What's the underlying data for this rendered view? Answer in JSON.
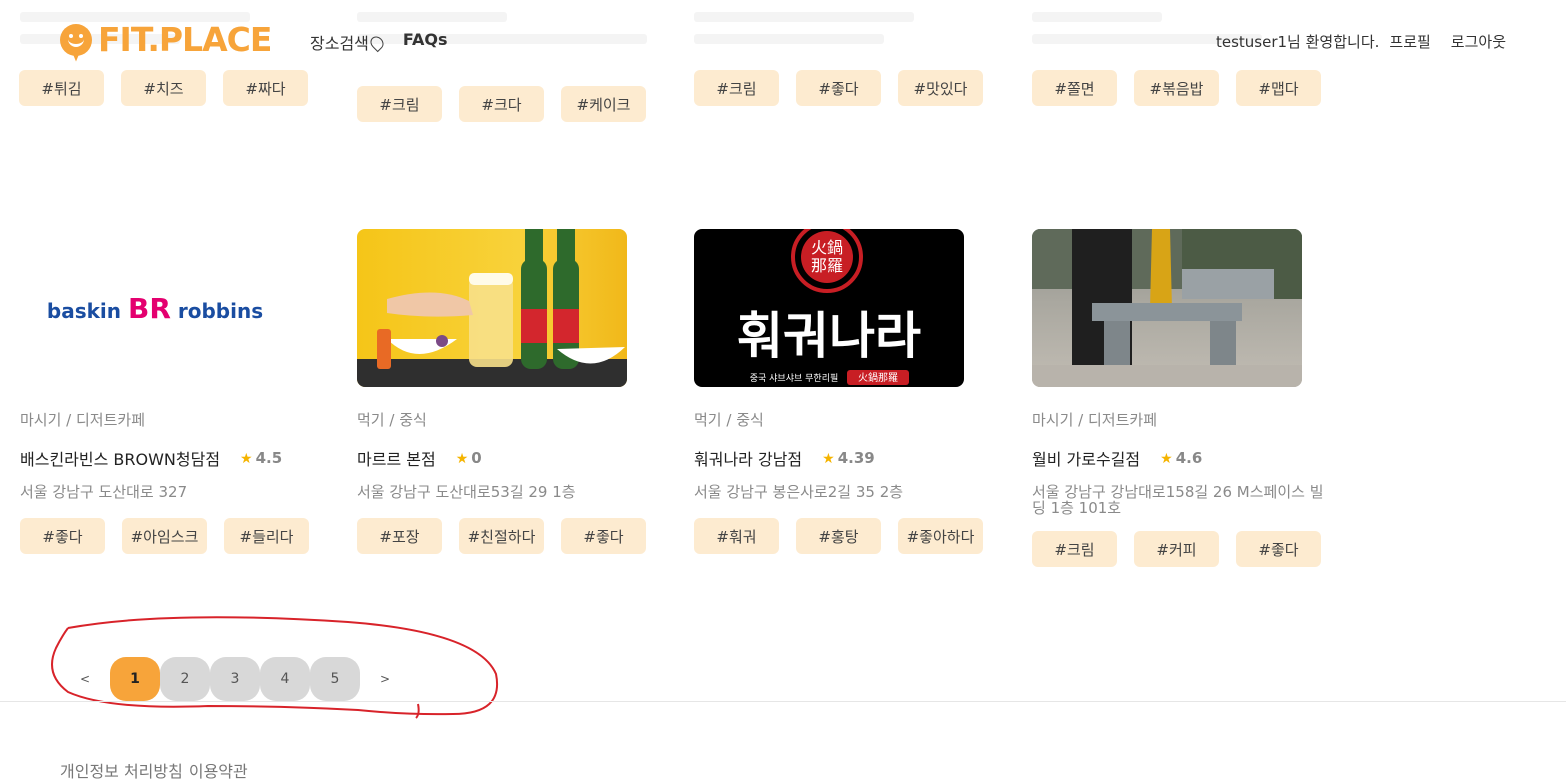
{
  "header": {
    "logo_text": "FIT.PLACE",
    "nav": [
      {
        "label": "장소검색",
        "icon": "map-pin-icon"
      },
      {
        "label": "FAQs"
      }
    ],
    "user": {
      "welcome": "testuser1님 환영합니다.",
      "profile": "프로필",
      "logout": "로그아웃"
    }
  },
  "top_row_tags": [
    [
      "#튀김",
      "#치즈",
      "#짜다"
    ],
    [
      "#크림",
      "#크다",
      "#케이크"
    ],
    [
      "#크림",
      "#좋다",
      "#맛있다"
    ],
    [
      "#쫄면",
      "#볶음밥",
      "#맵다"
    ]
  ],
  "cards": [
    {
      "image_alt": "baskin robbins logo",
      "logo_text_left": "baskin",
      "logo_text_br": "BR",
      "logo_text_right": "robbins",
      "category": "마시기 / 디저트카페",
      "title": "배스킨라빈스 BROWN청담점",
      "rating": "4.5",
      "address": "서울 강남구 도산대로 327",
      "tags": [
        "#좋다",
        "#아임스크",
        "#들리다"
      ]
    },
    {
      "image_alt": "beer and food",
      "category": "먹기 / 중식",
      "title": "마르르 본점",
      "rating": "0",
      "address": "서울 강남구 도산대로53길 29 1층",
      "tags": [
        "#포장",
        "#친절하다",
        "#좋다"
      ]
    },
    {
      "image_alt": "hwi-gwi-na-ra logo",
      "image_big_text": "훠궈나라",
      "image_sub_text": "중국 샤브샤브 무한리필",
      "image_badge": "火鍋那羅",
      "category": "먹기 / 중식",
      "title": "훠궈나라 강남점",
      "rating": "4.39",
      "address": "서울 강남구 봉은사로2길 35 2층",
      "tags": [
        "#훠궈",
        "#홍탕",
        "#좋아하다"
      ]
    },
    {
      "image_alt": "bench",
      "category": "마시기 / 디저트카페",
      "title": "월비 가로수길점",
      "rating": "4.6",
      "address": "서울 강남구 강남대로158길 26 M스페이스 빌딩 1층 101호",
      "tags": [
        "#크림",
        "#커피",
        "#좋다"
      ]
    }
  ],
  "pagination": {
    "prev": "<",
    "next": ">",
    "pages": [
      "1",
      "2",
      "3",
      "4",
      "5"
    ],
    "current": "1"
  },
  "footer": {
    "privacy": "개인정보 처리방침",
    "terms": "이용약관"
  },
  "colors": {
    "brand": "#f7a43a",
    "tag_bg": "#fdebd0",
    "star": "#f5b400",
    "annotation": "#d8232a"
  }
}
